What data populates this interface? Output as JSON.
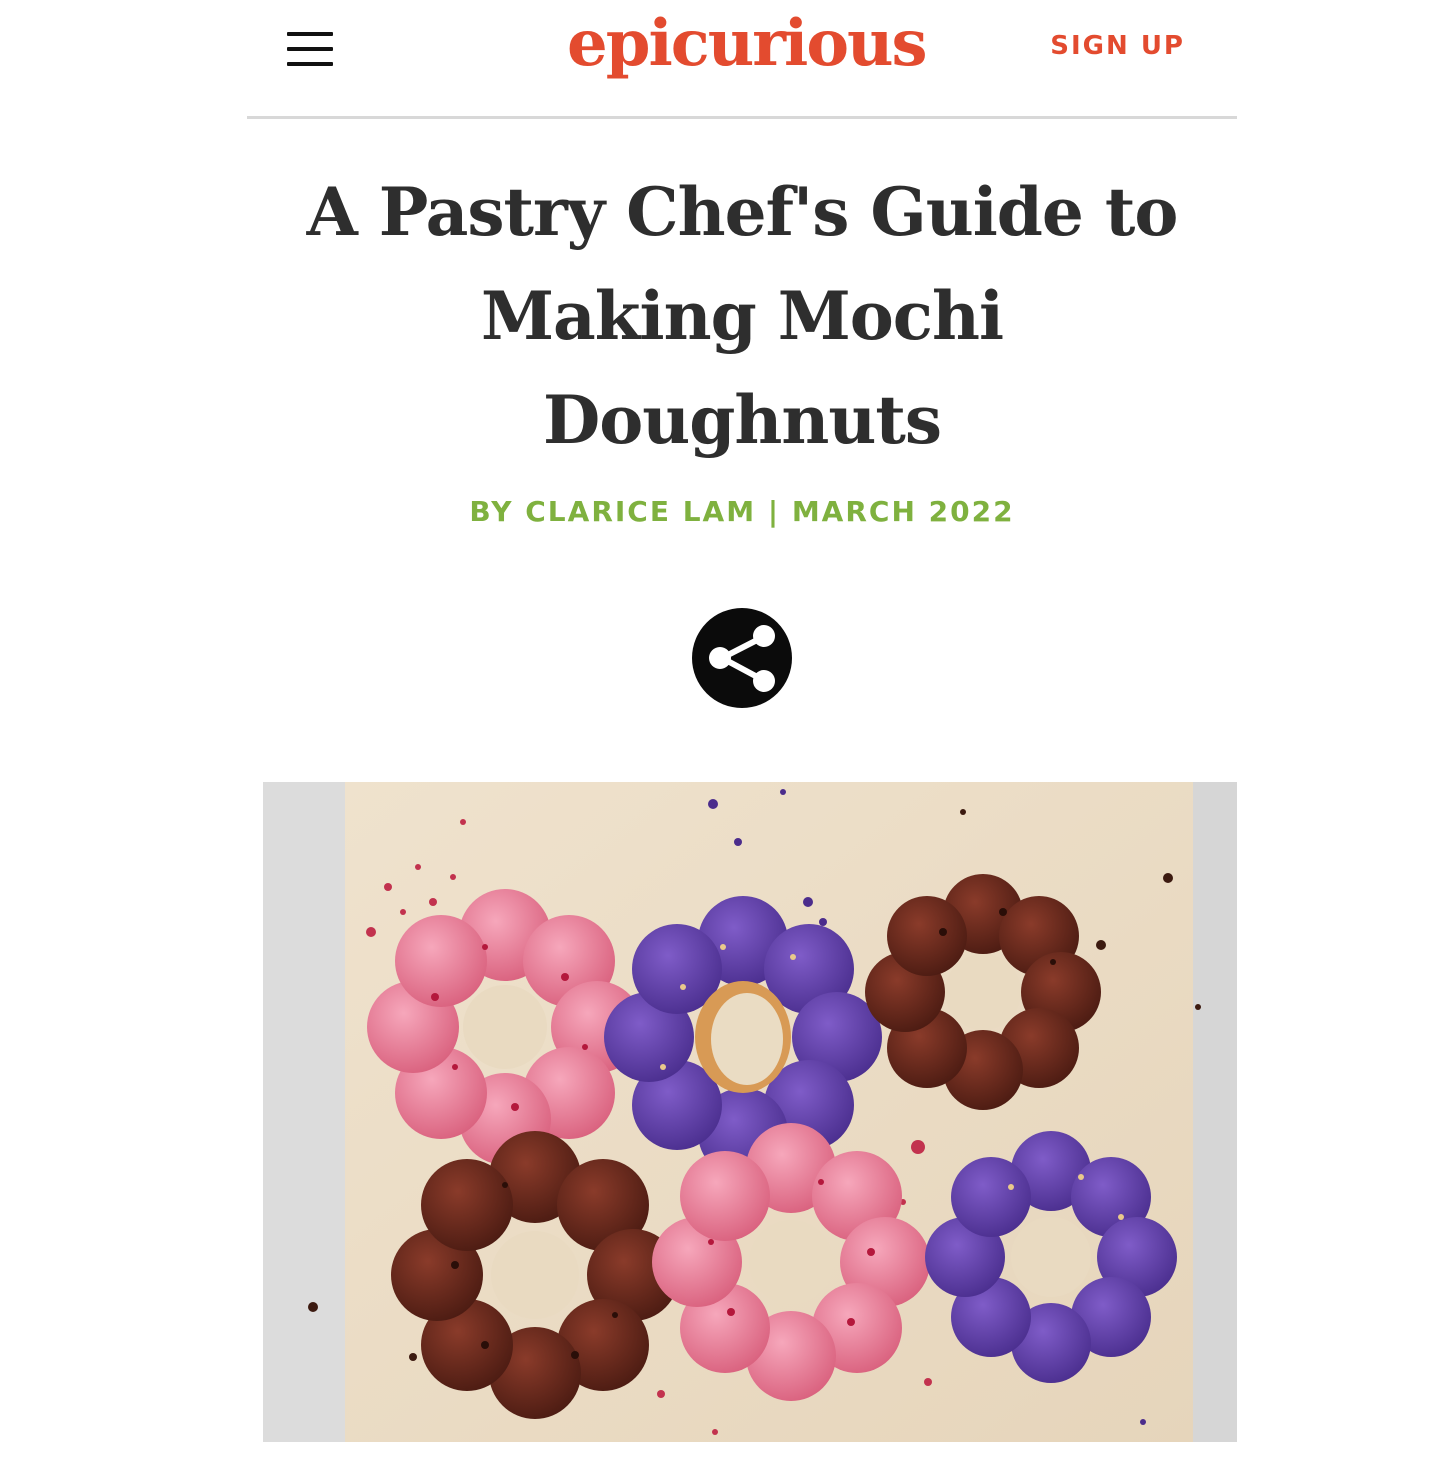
{
  "header": {
    "menu_icon": "hamburger-menu-icon",
    "logo_text": "epicurious",
    "signup_label": "SIGN UP"
  },
  "article": {
    "title_lines": [
      "A Pastry Chef's Guide to",
      "Making Mochi",
      "Doughnuts"
    ],
    "byline": "BY CLARICE LAM | MARCH 2022",
    "share_icon": "share-icon",
    "hero_image": "mochi-doughnuts-photo"
  },
  "colors": {
    "brand_red": "#e34b2f",
    "byline_green": "#7fb13f",
    "title_text": "#2e2e2e"
  }
}
